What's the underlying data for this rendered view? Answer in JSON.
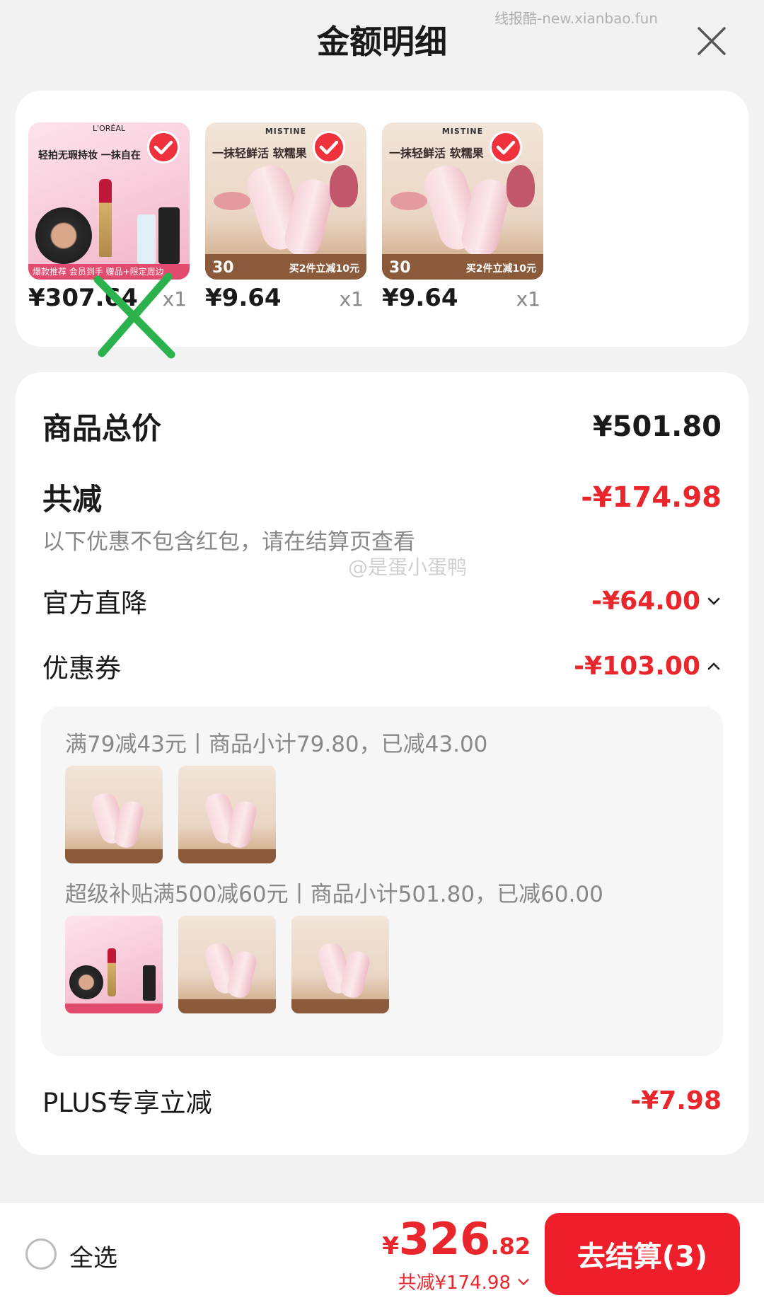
{
  "watermark": "线报酷-new.xianbao.fun",
  "header": {
    "title": "金额明细"
  },
  "products": [
    {
      "brand": "L'ORÉAL",
      "tagline": "轻拍无瑕持妆 一抹自在",
      "banner": "爆款推荐 会员到手 赠品+限定周边",
      "price": "¥307.64",
      "qty": "x1",
      "crossed_out": true
    },
    {
      "brand": "MISTINE",
      "tagline": "一抹轻鲜活 软糯果",
      "promo": "买2件立减10元",
      "badge": "30",
      "price": "¥9.64",
      "qty": "x1",
      "crossed_out": false
    },
    {
      "brand": "MISTINE",
      "tagline": "一抹轻鲜活 软糯果",
      "promo": "买2件立减10元",
      "badge": "30",
      "price": "¥9.64",
      "qty": "x1",
      "crossed_out": false
    }
  ],
  "summary": {
    "total_label": "商品总价",
    "total_value": "¥501.80",
    "discount_label": "共减",
    "discount_value": "-¥174.98",
    "discount_note": "以下优惠不包含红包，请在结算页查看",
    "official_label": "官方直降",
    "official_value": "-¥64.00",
    "coupon_label": "优惠券",
    "coupon_value": "-¥103.00",
    "plus_label": "PLUS专享立减",
    "plus_value": "-¥7.98"
  },
  "weibo_watermark": "@是蛋小蛋鸭",
  "coupons": [
    {
      "desc": "满79减43元丨商品小计79.80，已减43.00",
      "items": [
        "mistine",
        "mistine"
      ]
    },
    {
      "desc": "超级补贴满500减60元丨商品小计501.80，已减60.00",
      "items": [
        "loreal",
        "mistine",
        "mistine"
      ]
    }
  ],
  "bottom": {
    "select_all": "全选",
    "total_yen": "¥",
    "total_int": "326",
    "total_dec": ".82",
    "discount_note": "共减¥174.98",
    "checkout": "去结算(3)"
  },
  "colors": {
    "accent_red": "#e8262b",
    "button_red": "#ee1f2a",
    "check_red": "#f0323c",
    "x_green": "#2bb24c"
  },
  "icons": [
    "close-icon",
    "check-icon",
    "chevron-down-icon",
    "chevron-up-icon",
    "radio-icon"
  ]
}
